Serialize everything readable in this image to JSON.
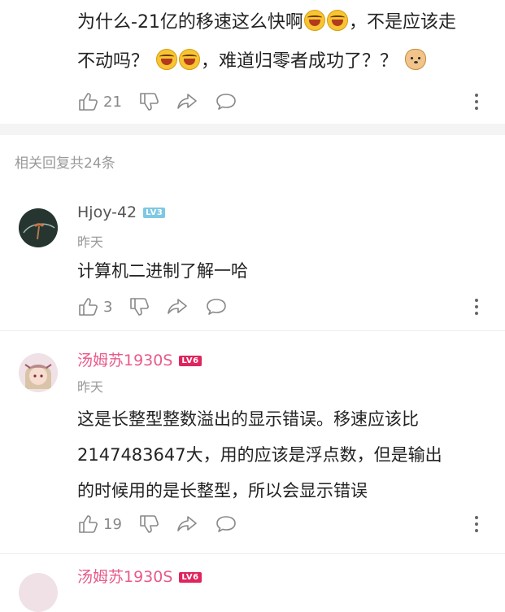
{
  "top_comment": {
    "line1": "为什么-21亿的移速这么快啊",
    "line1_end": "，不是应该走",
    "line2_start": "不动吗？",
    "line2_mid": "，难道归零者成功了？？",
    "emoji_laugh": "laugh-cry-emoji",
    "emoji_doge": "doge-emoji",
    "likes": "21"
  },
  "replies_header": "相关回复共24条",
  "replies": [
    {
      "username": "Hjoy-42",
      "level": "LV3",
      "level_color": "#7ec8e3",
      "name_color": "#555555",
      "date": "昨天",
      "text": "计算机二进制了解一哈",
      "likes": "3"
    },
    {
      "username": "汤姆苏1930S",
      "level": "LV6",
      "level_color": "#e0245e",
      "name_color": "#e85a8a",
      "date": "昨天",
      "text_lines": [
        "这是长整型整数溢出的显示错误。移速应该比",
        "2147483647大，用的应该是浮点数，但是输出",
        "的时候用的是长整型，所以会显示错误"
      ],
      "likes": "19"
    },
    {
      "username": "汤姆苏1930S",
      "level": "LV6"
    }
  ]
}
